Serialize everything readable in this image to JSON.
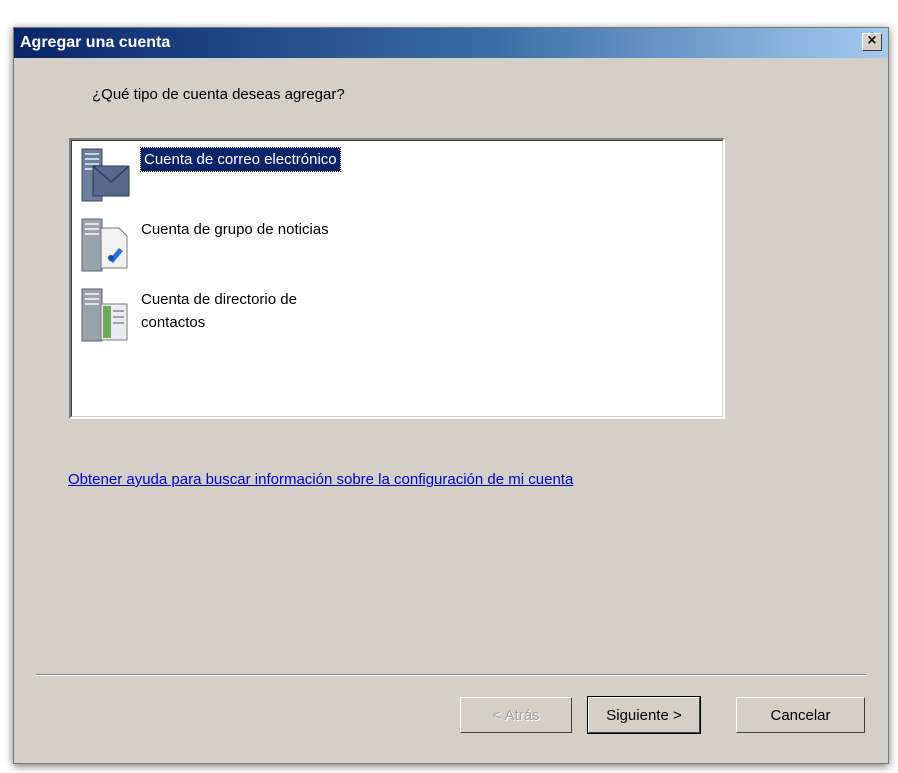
{
  "window": {
    "title": "Agregar una cuenta",
    "close_label": "×"
  },
  "question": "¿Qué tipo de cuenta deseas agregar?",
  "accounts": [
    {
      "label": "Cuenta de correo electrónico",
      "icon": "email-server-icon",
      "selected": true
    },
    {
      "label": "Cuenta de grupo de noticias",
      "icon": "newsgroup-server-icon",
      "selected": false
    },
    {
      "label": "Cuenta de directorio de\ncontactos",
      "icon": "directory-server-icon",
      "selected": false
    }
  ],
  "help_link": "Obtener ayuda para buscar información sobre la configuración de mi cuenta",
  "buttons": {
    "back": "< Atrás",
    "next": "Siguiente >",
    "cancel": "Cancelar"
  },
  "colors": {
    "title_start": "#0a246a",
    "title_end": "#a6caf0",
    "selection": "#0a246a",
    "link": "#0000cc"
  }
}
